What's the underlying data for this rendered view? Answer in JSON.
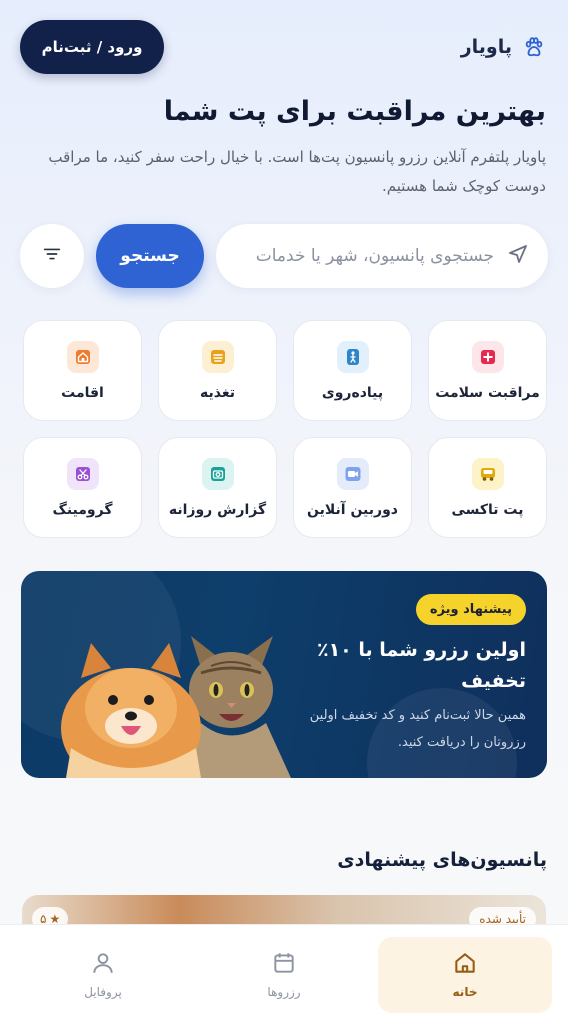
{
  "header": {
    "brand_name": "پاویار",
    "login_label": "ورود / ثبت‌نام"
  },
  "hero": {
    "title": "بهترین مراقبت برای پت شما",
    "subtitle": "پاویار پلتفرم آنلاین رزرو پانسیون پت‌ها است. با خیال راحت سفر کنید، ما مراقب دوست کوچک شما هستیم."
  },
  "search": {
    "placeholder": "جستجوی پانسیون، شهر یا خدمات",
    "button_label": "جستجو"
  },
  "services": [
    {
      "label": "مراقبت سلامت",
      "icon": "medical-cross-icon",
      "color": "#e5294f",
      "bg": "#fde6ea"
    },
    {
      "label": "پیاده‌روی",
      "icon": "walking-person-icon",
      "color": "#2f86c7",
      "bg": "#e2f0fb"
    },
    {
      "label": "تغذیه",
      "icon": "food-bowl-icon",
      "color": "#e9a21b",
      "bg": "#fdf0d2"
    },
    {
      "label": "اقامت",
      "icon": "house-icon",
      "color": "#f07b2c",
      "bg": "#fde7d6"
    },
    {
      "label": "پت تاکسی",
      "icon": "taxi-icon",
      "color": "#e2a90d",
      "bg": "#fdf2c8"
    },
    {
      "label": "دوربین آنلاین",
      "icon": "camera-video-icon",
      "color": "#4a7de0",
      "bg": "#e4ecfc"
    },
    {
      "label": "گزارش روزانه",
      "icon": "photo-camera-icon",
      "color": "#18a39a",
      "bg": "#dcf4f1"
    },
    {
      "label": "گرومینگ",
      "icon": "scissors-icon",
      "color": "#9a4fd6",
      "bg": "#f0e4fb"
    }
  ],
  "promo": {
    "badge": "پیشنهاد ویژه",
    "title": "اولین رزرو شما با ۱۰٪ تخفیف",
    "description": "همین حالا ثبت‌نام کنید و کد تخفیف اولین رزروتان را دریافت کنید."
  },
  "section": {
    "title": "پانسیون‌های پیشنهادی",
    "card_rating": "۵",
    "card_status": "تأیید شده"
  },
  "bottom_nav": [
    {
      "label": "خانه",
      "icon": "home-icon",
      "active": true
    },
    {
      "label": "رزروها",
      "icon": "calendar-icon",
      "active": false
    },
    {
      "label": "پروفایل",
      "icon": "user-icon",
      "active": false
    }
  ],
  "colors": {
    "primary": "#2f63d4",
    "dark": "#12214a",
    "badge": "#f5d32a",
    "active_nav": "#9a5b12"
  }
}
